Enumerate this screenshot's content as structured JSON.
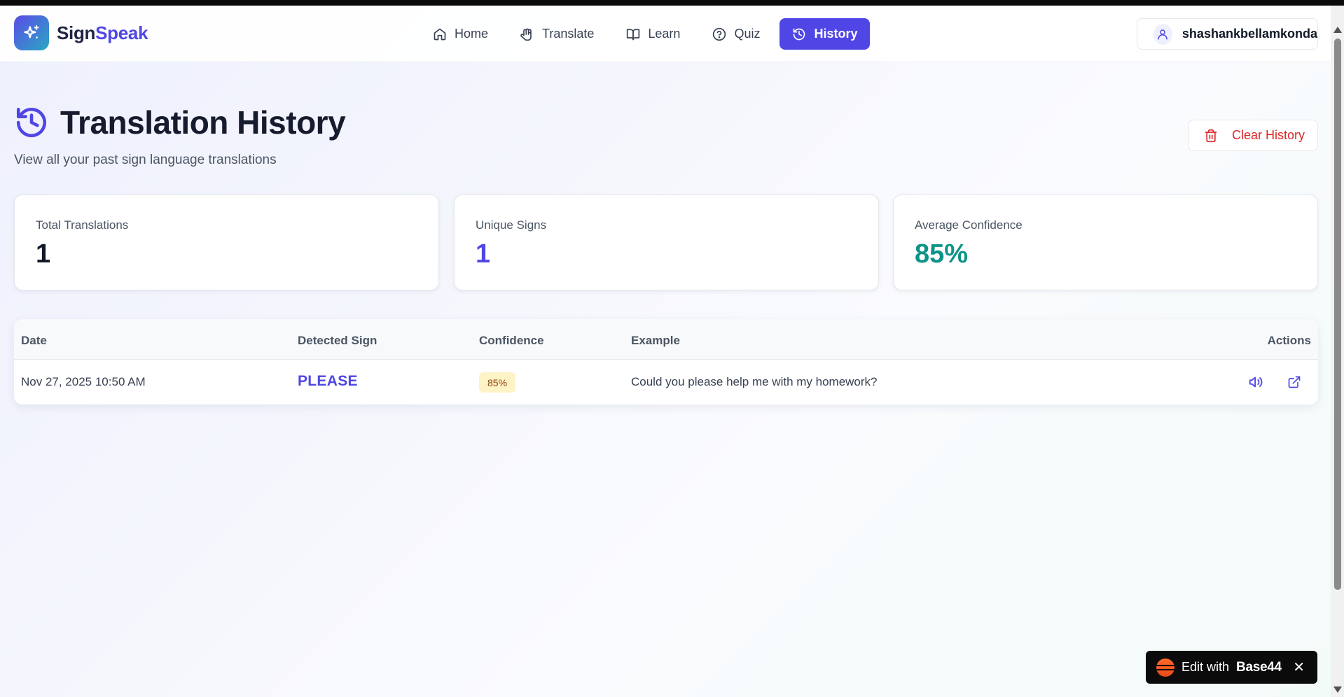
{
  "brand": {
    "name_part1": "Sign",
    "name_part2": "Speak",
    "logo_icon": "sparkles-icon"
  },
  "nav": {
    "items": [
      {
        "label": "Home",
        "icon": "home-icon",
        "active": false
      },
      {
        "label": "Translate",
        "icon": "hand-icon",
        "active": false
      },
      {
        "label": "Learn",
        "icon": "book-icon",
        "active": false
      },
      {
        "label": "Quiz",
        "icon": "help-circle-icon",
        "active": false
      },
      {
        "label": "History",
        "icon": "history-icon",
        "active": true
      }
    ]
  },
  "user": {
    "name": "shashankbellamkonda",
    "icon": "user-icon"
  },
  "page": {
    "title": "Translation History",
    "subtitle": "View all your past sign language translations",
    "clear_button": "Clear History"
  },
  "stats": [
    {
      "label": "Total Translations",
      "value": "1",
      "color": "#111827"
    },
    {
      "label": "Unique Signs",
      "value": "1",
      "color": "#4f46e5"
    },
    {
      "label": "Average Confidence",
      "value": "85%",
      "color": "#0d9488"
    }
  ],
  "table": {
    "columns": [
      "Date",
      "Detected Sign",
      "Confidence",
      "Example",
      "Actions"
    ],
    "rows": [
      {
        "date": "Nov 27, 2025 10:50 AM",
        "sign": "PLEASE",
        "confidence": "85%",
        "example": "Could you please help me with my homework?"
      }
    ]
  },
  "edit_widget": {
    "prefix": "Edit with",
    "brand": "Base44",
    "close": "✕"
  },
  "colors": {
    "accent": "#4f46e5",
    "danger": "#dc2626",
    "teal": "#0d9488"
  }
}
